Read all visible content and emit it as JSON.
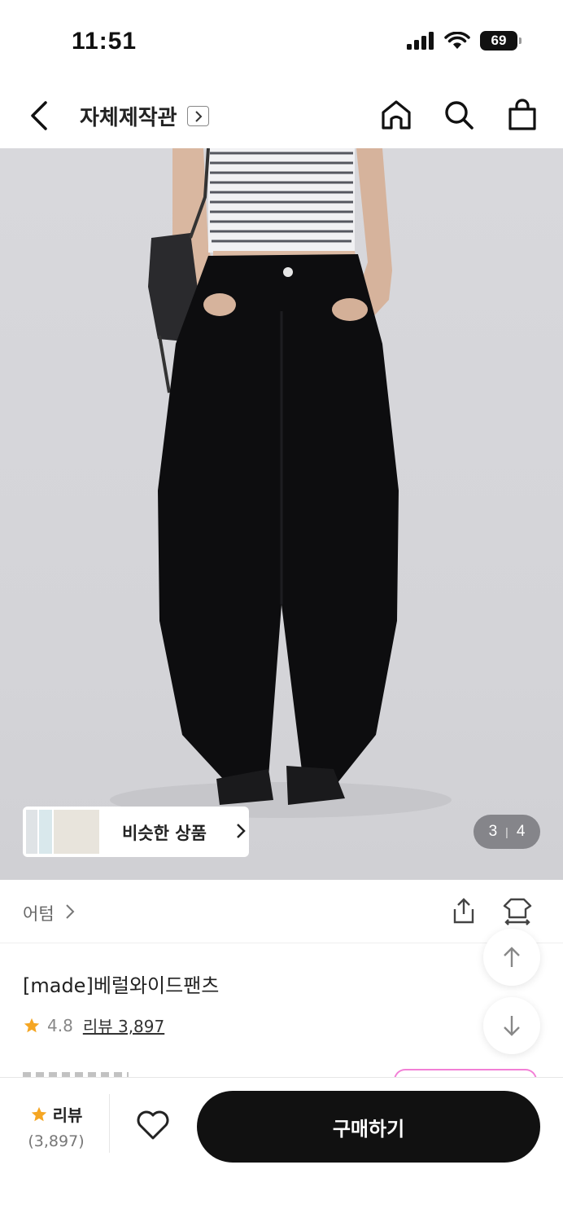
{
  "status_bar": {
    "time": "11:51",
    "battery": "69"
  },
  "nav": {
    "title": "자체제작관"
  },
  "hero": {
    "similar_label": "비슷한 상품",
    "page_current": "3",
    "page_total": "4"
  },
  "brand": {
    "name": "어텀"
  },
  "product": {
    "name": "[made]베럴와이드팬츠",
    "rating": "4.8",
    "review_label": "리뷰 3,897"
  },
  "bottom_bar": {
    "review_label": "리뷰",
    "review_count": "(3,897)",
    "buy_label": "구매하기"
  },
  "colors": {
    "star": "#f5a623",
    "buy_button": "#111111",
    "pill_outline": "#f27fd6"
  }
}
